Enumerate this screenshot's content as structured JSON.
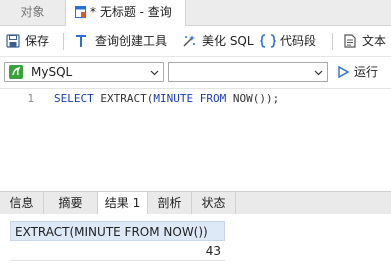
{
  "tabs": {
    "objects": "对象",
    "query": "* 无标题 - 查询"
  },
  "toolbar": {
    "save": "保存",
    "query_builder": "查询创建工具",
    "beautify": "美化 SQL",
    "snippet": "代码段",
    "text": "文本"
  },
  "connection": {
    "selected": "MySQL",
    "database": "",
    "run": "运行"
  },
  "editor": {
    "line_number": "1",
    "tokens": [
      "SELECT",
      " EXTRACT(",
      "MINUTE",
      " ",
      "FROM",
      " NOW());"
    ]
  },
  "result_tabs": [
    "信息",
    "摘要",
    "结果 1",
    "剖析",
    "状态"
  ],
  "active_result_tab": "结果 1",
  "grid": {
    "column": "EXTRACT(MINUTE FROM NOW())",
    "value": "43"
  },
  "colors": {
    "keyword": "#1a3cb8",
    "accent": "#2a6fd6",
    "connection_icon": "#3aa23a",
    "header_bg": "#dde9f6"
  },
  "icons": [
    "save-icon",
    "query-builder-icon",
    "beautify-icon",
    "snippet-icon",
    "text-icon",
    "mysql-icon",
    "run-icon",
    "chevron-down-icon",
    "query-tab-icon"
  ]
}
